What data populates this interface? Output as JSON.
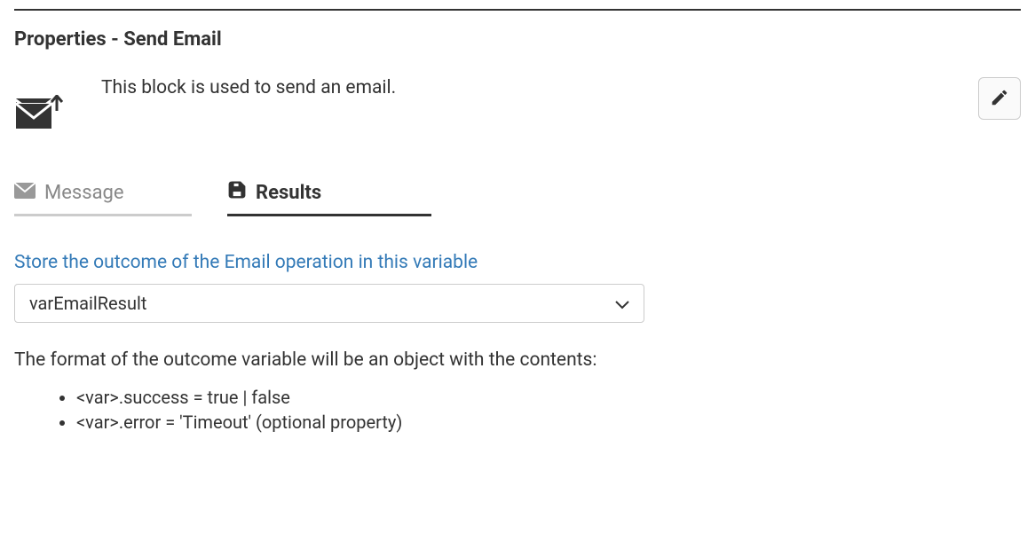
{
  "panel": {
    "title": "Properties - Send Email",
    "description": "This block is used to send an email."
  },
  "tabs": {
    "message": {
      "label": "Message"
    },
    "results": {
      "label": "Results"
    }
  },
  "results": {
    "field_label": "Store the outcome of the Email operation in this variable",
    "selected_value": "varEmailResult",
    "format_intro": "The format of the outcome variable will be an object with the contents:",
    "format_items": [
      "<var>.success = true | false",
      "<var>.error = 'Timeout' (optional property)"
    ]
  }
}
